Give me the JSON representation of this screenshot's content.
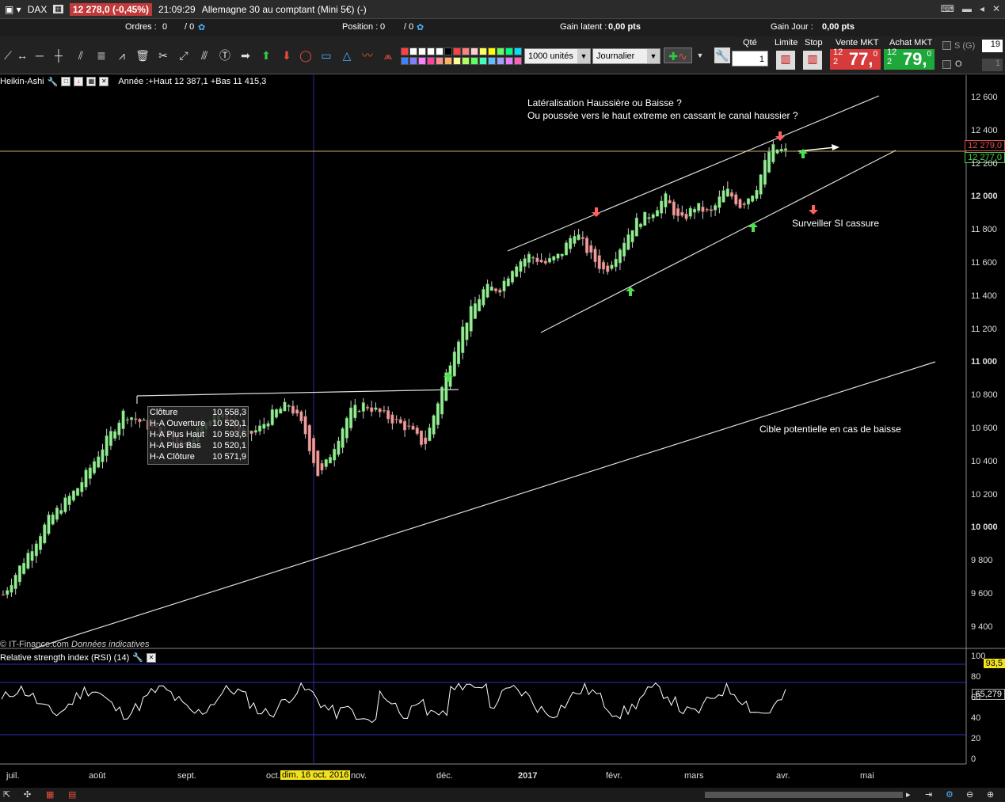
{
  "titlebar": {
    "symbol": "DAX",
    "change": "12 278,0 (-0,45%)",
    "time": "21:09:29",
    "name": "Allemagne 30 au comptant (Mini 5€) (-)"
  },
  "infobar": {
    "orders_label": "Ordres :",
    "orders_value": "0",
    "orders_value2": "/ 0",
    "position_label": "Position :",
    "position_value": "0",
    "position_value2": "/ 0",
    "gain_latent_label": "Gain latent :",
    "gain_latent_value": "0,00 pts",
    "gain_jour_label": "Gain Jour :",
    "gain_jour_value": "0,00 pts"
  },
  "toolbar": {
    "units_select": "1000 unités",
    "period_select": "Journalier",
    "qty_label": "Qté",
    "qty_value": "1",
    "limit_label": "Limite",
    "stop_label": "Stop",
    "sell_label": "Vente MKT",
    "buy_label": "Achat MKT",
    "sell_small": "12 2",
    "sell_big": "77,",
    "sell_sup": "0",
    "buy_small": "12 2",
    "buy_big": "79,",
    "buy_sup": "0",
    "sg_label": "S (G)",
    "sg_value": "19",
    "o_label": "O",
    "o_value": "1"
  },
  "chart": {
    "indicator": "Heikin-Ashi",
    "period_info": "Année :+Haut 12 387,1 +Bas 11 415,3",
    "copyright": "© IT-Finance.com",
    "disclaimer": "Données indicatives",
    "annotation1": "Latéralisation Haussière ou Baisse ?",
    "annotation2": "Ou poussée vers le haut extreme en cassant le canal haussier ?",
    "annotation3": "Surveiller SI cassure",
    "annotation4": "Cible potentielle en cas de baisse",
    "price_tag_red": "12 279,0",
    "price_tag_green": "12 277,0",
    "yticks": [
      "12 600",
      "12 400",
      "12 200",
      "12 000",
      "11 800",
      "11 600",
      "11 400",
      "11 200",
      "11 000",
      "10 800",
      "10 600",
      "10 400",
      "10 200",
      "10 000",
      "9 800",
      "9 600",
      "9 400"
    ],
    "tooltip": [
      {
        "k": "Clôture",
        "v": "10 558,3"
      },
      {
        "k": "H-A Ouverture",
        "v": "10 520,1"
      },
      {
        "k": "H-A Plus Haut",
        "v": "10 593,6"
      },
      {
        "k": "H-A Plus Bas",
        "v": "10 520,1"
      },
      {
        "k": "H-A Clôture",
        "v": "10 571,9"
      }
    ]
  },
  "rsi": {
    "title": "Relative strength index (RSI) (14)",
    "ticks": [
      "100",
      "80",
      "60",
      "40",
      "20",
      "0"
    ],
    "tag_yellow": "93,5",
    "tag_value": "65,279"
  },
  "xaxis": {
    "labels": [
      "juil.",
      "août",
      "sept.",
      "oct.",
      "nov.",
      "déc.",
      "2017",
      "févr.",
      "mars",
      "avr.",
      "mai"
    ],
    "highlight": "dim. 16 oct. 2016"
  },
  "chart_data": {
    "type": "candlestick",
    "title": "",
    "ylim": [
      9300,
      12700
    ],
    "approx_daily_closes": [
      9600,
      9750,
      9900,
      10050,
      10150,
      10250,
      10400,
      10550,
      10700,
      10650,
      10600,
      10550,
      10500,
      10600,
      10700,
      10650,
      10550,
      10600,
      10700,
      10750,
      10600,
      10300,
      10500,
      10700,
      10750,
      10700,
      10650,
      10600,
      10500,
      10800,
      11100,
      11300,
      11450,
      11450,
      11600,
      11650,
      11600,
      11650,
      11800,
      11650,
      11550,
      11700,
      11850,
      11900,
      12000,
      11850,
      11950,
      11900,
      12050,
      11950,
      12050,
      12300,
      12278
    ]
  }
}
